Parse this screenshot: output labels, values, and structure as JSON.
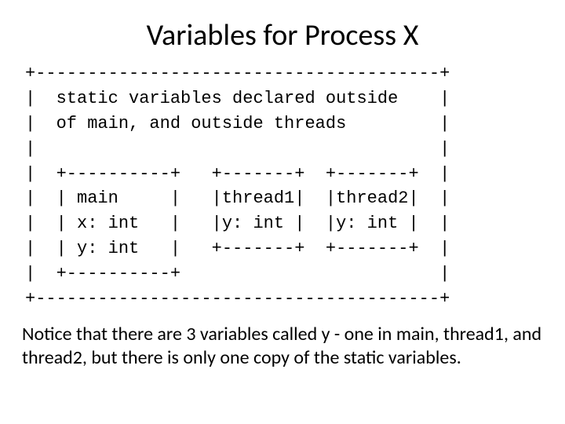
{
  "title": "Variables for Process X",
  "diagram_lines": {
    "l0": "+---------------------------------------+",
    "l1": "|  static variables declared outside    |",
    "l2": "|  of main, and outside threads         |",
    "l3": "|                                       |",
    "l4": "|  +----------+   +-------+  +-------+  |",
    "l5": "|  | main     |   |thread1|  |thread2|  |",
    "l6": "|  | x: int   |   |y: int |  |y: int |  |",
    "l7": "|  | y: int   |   +-------+  +-------+  |",
    "l8": "|  +----------+                         |",
    "l9": "+---------------------------------------+"
  },
  "caption": "Notice that there are 3 variables called y - one in main, thread1, and thread2, but there is only one copy of the static variables."
}
